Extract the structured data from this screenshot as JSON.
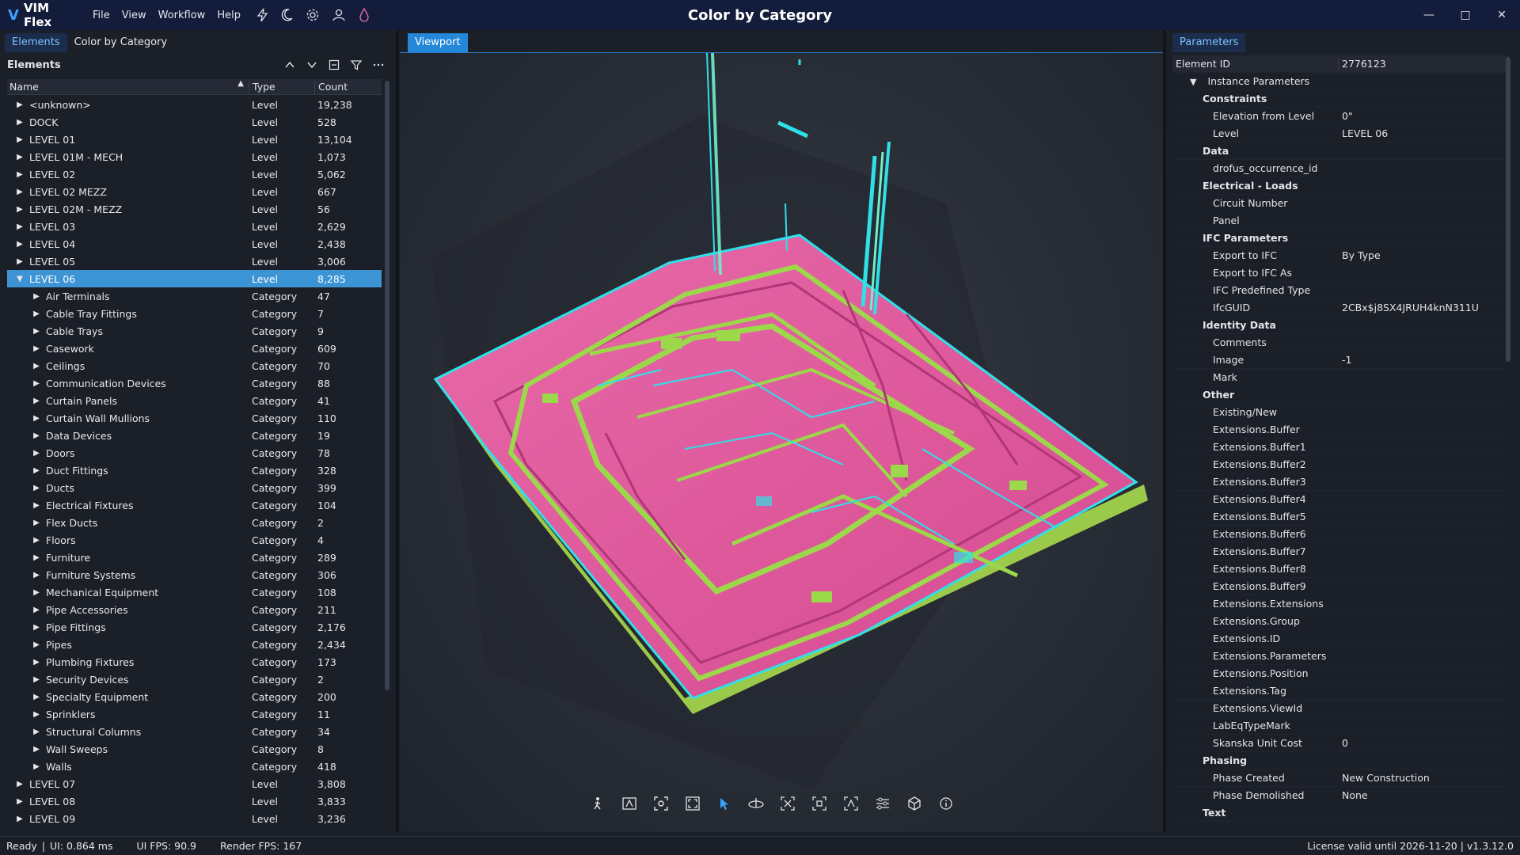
{
  "app": {
    "logo_text": "VIM Flex",
    "window_title": "Color by Category",
    "menus": [
      "File",
      "View",
      "Workflow",
      "Help"
    ],
    "title_icons": [
      "lightning-icon",
      "moon-icon",
      "gear-icon",
      "user-icon",
      "drop-icon"
    ]
  },
  "left": {
    "tabs": [
      "Elements",
      "Color by Category"
    ],
    "panel_title": "Elements",
    "columns": {
      "name": "Name",
      "type": "Type",
      "count": "Count"
    },
    "rows": [
      {
        "name": "<unknown>",
        "type": "Level",
        "count": "19,238",
        "depth": 0,
        "expanded": false
      },
      {
        "name": "DOCK",
        "type": "Level",
        "count": "528",
        "depth": 0,
        "expanded": false
      },
      {
        "name": "LEVEL 01",
        "type": "Level",
        "count": "13,104",
        "depth": 0,
        "expanded": false
      },
      {
        "name": "LEVEL 01M - MECH",
        "type": "Level",
        "count": "1,073",
        "depth": 0,
        "expanded": false
      },
      {
        "name": "LEVEL 02",
        "type": "Level",
        "count": "5,062",
        "depth": 0,
        "expanded": false
      },
      {
        "name": "LEVEL 02 MEZZ",
        "type": "Level",
        "count": "667",
        "depth": 0,
        "expanded": false
      },
      {
        "name": "LEVEL 02M - MEZZ",
        "type": "Level",
        "count": "56",
        "depth": 0,
        "expanded": false
      },
      {
        "name": "LEVEL 03",
        "type": "Level",
        "count": "2,629",
        "depth": 0,
        "expanded": false
      },
      {
        "name": "LEVEL 04",
        "type": "Level",
        "count": "2,438",
        "depth": 0,
        "expanded": false
      },
      {
        "name": "LEVEL 05",
        "type": "Level",
        "count": "3,006",
        "depth": 0,
        "expanded": false
      },
      {
        "name": "LEVEL 06",
        "type": "Level",
        "count": "8,285",
        "depth": 0,
        "expanded": true,
        "selected": true
      },
      {
        "name": "Air Terminals",
        "type": "Category",
        "count": "47",
        "depth": 1,
        "expanded": false
      },
      {
        "name": "Cable Tray Fittings",
        "type": "Category",
        "count": "7",
        "depth": 1,
        "expanded": false
      },
      {
        "name": "Cable Trays",
        "type": "Category",
        "count": "9",
        "depth": 1,
        "expanded": false
      },
      {
        "name": "Casework",
        "type": "Category",
        "count": "609",
        "depth": 1,
        "expanded": false
      },
      {
        "name": "Ceilings",
        "type": "Category",
        "count": "70",
        "depth": 1,
        "expanded": false
      },
      {
        "name": "Communication Devices",
        "type": "Category",
        "count": "88",
        "depth": 1,
        "expanded": false
      },
      {
        "name": "Curtain Panels",
        "type": "Category",
        "count": "41",
        "depth": 1,
        "expanded": false
      },
      {
        "name": "Curtain Wall Mullions",
        "type": "Category",
        "count": "110",
        "depth": 1,
        "expanded": false
      },
      {
        "name": "Data Devices",
        "type": "Category",
        "count": "19",
        "depth": 1,
        "expanded": false
      },
      {
        "name": "Doors",
        "type": "Category",
        "count": "78",
        "depth": 1,
        "expanded": false
      },
      {
        "name": "Duct Fittings",
        "type": "Category",
        "count": "328",
        "depth": 1,
        "expanded": false
      },
      {
        "name": "Ducts",
        "type": "Category",
        "count": "399",
        "depth": 1,
        "expanded": false
      },
      {
        "name": "Electrical Fixtures",
        "type": "Category",
        "count": "104",
        "depth": 1,
        "expanded": false
      },
      {
        "name": "Flex Ducts",
        "type": "Category",
        "count": "2",
        "depth": 1,
        "expanded": false
      },
      {
        "name": "Floors",
        "type": "Category",
        "count": "4",
        "depth": 1,
        "expanded": false
      },
      {
        "name": "Furniture",
        "type": "Category",
        "count": "289",
        "depth": 1,
        "expanded": false
      },
      {
        "name": "Furniture Systems",
        "type": "Category",
        "count": "306",
        "depth": 1,
        "expanded": false
      },
      {
        "name": "Mechanical Equipment",
        "type": "Category",
        "count": "108",
        "depth": 1,
        "expanded": false
      },
      {
        "name": "Pipe Accessories",
        "type": "Category",
        "count": "211",
        "depth": 1,
        "expanded": false
      },
      {
        "name": "Pipe Fittings",
        "type": "Category",
        "count": "2,176",
        "depth": 1,
        "expanded": false
      },
      {
        "name": "Pipes",
        "type": "Category",
        "count": "2,434",
        "depth": 1,
        "expanded": false
      },
      {
        "name": "Plumbing Fixtures",
        "type": "Category",
        "count": "173",
        "depth": 1,
        "expanded": false
      },
      {
        "name": "Security Devices",
        "type": "Category",
        "count": "2",
        "depth": 1,
        "expanded": false
      },
      {
        "name": "Specialty Equipment",
        "type": "Category",
        "count": "200",
        "depth": 1,
        "expanded": false
      },
      {
        "name": "Sprinklers",
        "type": "Category",
        "count": "11",
        "depth": 1,
        "expanded": false
      },
      {
        "name": "Structural Columns",
        "type": "Category",
        "count": "34",
        "depth": 1,
        "expanded": false
      },
      {
        "name": "Wall Sweeps",
        "type": "Category",
        "count": "8",
        "depth": 1,
        "expanded": false
      },
      {
        "name": "Walls",
        "type": "Category",
        "count": "418",
        "depth": 1,
        "expanded": false
      },
      {
        "name": "LEVEL 07",
        "type": "Level",
        "count": "3,808",
        "depth": 0,
        "expanded": false
      },
      {
        "name": "LEVEL 08",
        "type": "Level",
        "count": "3,833",
        "depth": 0,
        "expanded": false
      },
      {
        "name": "LEVEL 09",
        "type": "Level",
        "count": "3,236",
        "depth": 0,
        "expanded": false
      }
    ]
  },
  "viewport": {
    "tab": "Viewport",
    "tools": [
      "walk-icon",
      "annotate-icon",
      "focus-icon",
      "fullscreen-icon",
      "select-arrow-icon",
      "orbit-icon",
      "isolate-icon",
      "frame-icon",
      "measure-icon",
      "settings-sliders-icon",
      "cube-icon",
      "info-icon"
    ],
    "colors": {
      "floor": "#e0569c",
      "duct": "#9bd84a",
      "pipe": "#2fe0e8",
      "background": "#2b2f37"
    }
  },
  "right": {
    "tab": "Parameters",
    "element_id_label": "Element ID",
    "element_id_value": "2776123",
    "instance_label": "Instance Parameters",
    "params": [
      {
        "kind": "group",
        "key": "Constraints",
        "value": ""
      },
      {
        "kind": "param",
        "key": "Elevation from Level",
        "value": "0\""
      },
      {
        "kind": "param",
        "key": "Level",
        "value": "LEVEL 06"
      },
      {
        "kind": "group",
        "key": "Data",
        "value": ""
      },
      {
        "kind": "param",
        "key": "drofus_occurrence_id",
        "value": ""
      },
      {
        "kind": "group",
        "key": "Electrical - Loads",
        "value": ""
      },
      {
        "kind": "param",
        "key": "Circuit Number",
        "value": ""
      },
      {
        "kind": "param",
        "key": "Panel",
        "value": ""
      },
      {
        "kind": "group",
        "key": "IFC Parameters",
        "value": ""
      },
      {
        "kind": "param",
        "key": "Export to IFC",
        "value": "By Type"
      },
      {
        "kind": "param",
        "key": "Export to IFC As",
        "value": ""
      },
      {
        "kind": "param",
        "key": "IFC Predefined Type",
        "value": ""
      },
      {
        "kind": "param",
        "key": "IfcGUID",
        "value": "2CBx$j8SX4JRUH4knN311U"
      },
      {
        "kind": "group",
        "key": "Identity Data",
        "value": ""
      },
      {
        "kind": "param",
        "key": "Comments",
        "value": ""
      },
      {
        "kind": "param",
        "key": "Image",
        "value": "-1"
      },
      {
        "kind": "param",
        "key": "Mark",
        "value": ""
      },
      {
        "kind": "group",
        "key": "Other",
        "value": ""
      },
      {
        "kind": "param",
        "key": "Existing/New",
        "value": ""
      },
      {
        "kind": "param",
        "key": "Extensions.Buffer",
        "value": ""
      },
      {
        "kind": "param",
        "key": "Extensions.Buffer1",
        "value": ""
      },
      {
        "kind": "param",
        "key": "Extensions.Buffer2",
        "value": ""
      },
      {
        "kind": "param",
        "key": "Extensions.Buffer3",
        "value": ""
      },
      {
        "kind": "param",
        "key": "Extensions.Buffer4",
        "value": ""
      },
      {
        "kind": "param",
        "key": "Extensions.Buffer5",
        "value": ""
      },
      {
        "kind": "param",
        "key": "Extensions.Buffer6",
        "value": ""
      },
      {
        "kind": "param",
        "key": "Extensions.Buffer7",
        "value": ""
      },
      {
        "kind": "param",
        "key": "Extensions.Buffer8",
        "value": ""
      },
      {
        "kind": "param",
        "key": "Extensions.Buffer9",
        "value": ""
      },
      {
        "kind": "param",
        "key": "Extensions.Extensions",
        "value": ""
      },
      {
        "kind": "param",
        "key": "Extensions.Group",
        "value": ""
      },
      {
        "kind": "param",
        "key": "Extensions.ID",
        "value": ""
      },
      {
        "kind": "param",
        "key": "Extensions.Parameters",
        "value": ""
      },
      {
        "kind": "param",
        "key": "Extensions.Position",
        "value": ""
      },
      {
        "kind": "param",
        "key": "Extensions.Tag",
        "value": ""
      },
      {
        "kind": "param",
        "key": "Extensions.ViewId",
        "value": ""
      },
      {
        "kind": "param",
        "key": "LabEqTypeMark",
        "value": ""
      },
      {
        "kind": "param",
        "key": "Skanska Unit Cost",
        "value": "0"
      },
      {
        "kind": "group",
        "key": "Phasing",
        "value": ""
      },
      {
        "kind": "param",
        "key": "Phase Created",
        "value": "New Construction"
      },
      {
        "kind": "param",
        "key": "Phase Demolished",
        "value": "None"
      },
      {
        "kind": "group",
        "key": "Text",
        "value": ""
      }
    ]
  },
  "status": {
    "ready": "Ready",
    "ui_time": "UI: 0.864 ms",
    "ui_fps": "UI FPS: 90.9",
    "render_fps": "Render FPS: 167",
    "license": "License valid until 2026-11-20",
    "version": "v1.3.12.0"
  }
}
